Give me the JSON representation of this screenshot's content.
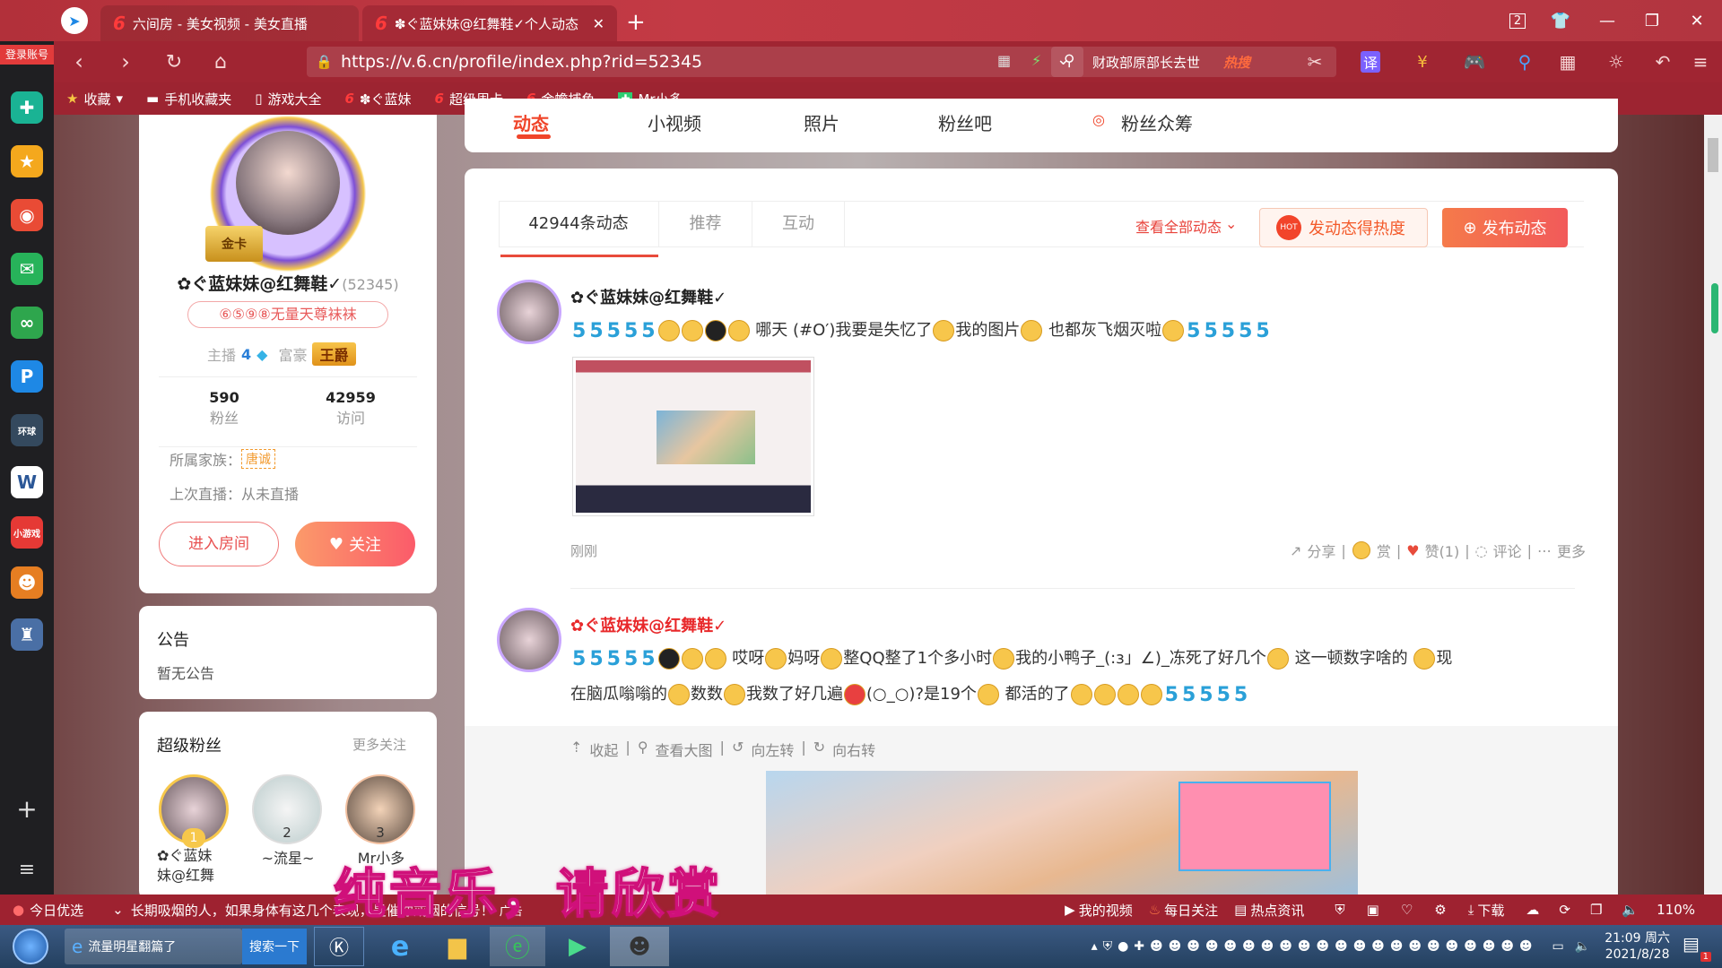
{
  "browser": {
    "tabs": [
      {
        "label": "六间房 - 美女视频 - 美女直播"
      },
      {
        "label": "✽ぐ蓝妹妹@红舞鞋✓个人动态"
      }
    ],
    "tab_counter": "2",
    "url": "https://v.6.cn/profile/index.php?rid=52345",
    "search_text": "财政部原部长去世",
    "search_badge": "热搜",
    "login_label": "登录账号",
    "translate_label": "译",
    "bookmarks": [
      "收藏",
      "手机收藏夹",
      "游戏大全",
      "✽ぐ蓝妹",
      "超级周卡",
      "金蟾捕鱼",
      "Mr小多"
    ]
  },
  "nav_tabs": [
    "动态",
    "小视频",
    "照片",
    "粉丝吧",
    "粉丝众筹"
  ],
  "profile": {
    "name": "✿ぐ蓝妹妹@红舞鞋✓",
    "rid": "(52345)",
    "title_badge": "⑥⑤⑨⑧无量天尊袜袜",
    "gold_label": "金卡",
    "anchor_label": "主播",
    "anchor_level": "4",
    "rich_label": "富豪",
    "rich_badge": "王爵",
    "fans_count": "590",
    "fans_label": "粉丝",
    "visits_count": "42959",
    "visits_label": "访问",
    "family_label": "所属家族：",
    "family_badge": "唐诚",
    "last_live": "上次直播：从未直播",
    "enter_room": "进入房间",
    "follow": "关注"
  },
  "announce": {
    "title": "公告",
    "text": "暂无公告"
  },
  "super_fans": {
    "title": "超级粉丝",
    "more": "更多关注",
    "fans": [
      {
        "rank": "1",
        "name": "✿ぐ蓝妹\n妹@红舞"
      },
      {
        "rank": "2",
        "name": "~流星~"
      },
      {
        "rank": "3",
        "name": "Mr小多"
      }
    ]
  },
  "feed": {
    "tabs": [
      "42944条动态",
      "推荐",
      "互动"
    ],
    "view_all": "查看全部动态",
    "heat_btn": "发动态得热度",
    "hot_label": "HOT",
    "publish_btn": "发布动态",
    "posts": [
      {
        "author": "✿ぐ蓝妹妹@红舞鞋✓",
        "t1": "哪天 (#O′)我要是失忆了",
        "t2": "我的图片",
        "t3": "也都灰飞烟灭啦",
        "time": "刚刚",
        "actions": [
          "分享",
          "赏",
          "赞(1)",
          "评论",
          "更多"
        ]
      },
      {
        "author": "✿ぐ蓝妹妹@红舞鞋✓",
        "t1": "哎呀",
        "t2": "妈呀",
        "t3": "整QQ整了1个多小时",
        "t4": "我的小鸭子_(:з」∠)_冻死了好几个",
        "t5": "这一顿数字啥的",
        "t6": "现",
        "line2a": "在脑瓜嗡嗡的",
        "line2b": "数数",
        "line2c": "我数了好几遍",
        "line2d": "(○_○)?是19个",
        "line2e": "都活的了",
        "img_actions": [
          "收起",
          "查看大图",
          "向左转",
          "向右转"
        ]
      }
    ],
    "five_char": "5"
  },
  "overlay_text": "纯音乐，请欣赏",
  "status": {
    "today": "今日优选",
    "news": "长期吸烟的人，如果身体有这几个表现，是催你戒烟的信号！",
    "ad": "广告",
    "my_video": "我的视频",
    "daily": "每日关注",
    "hot_news": "热点资讯",
    "download": "下载",
    "zoom": "110%"
  },
  "taskbar": {
    "item1": "流量明星翻篇了",
    "search": "搜索一下",
    "time": "21:09 周六",
    "date": "2021/8/28",
    "notify_count": "1"
  }
}
